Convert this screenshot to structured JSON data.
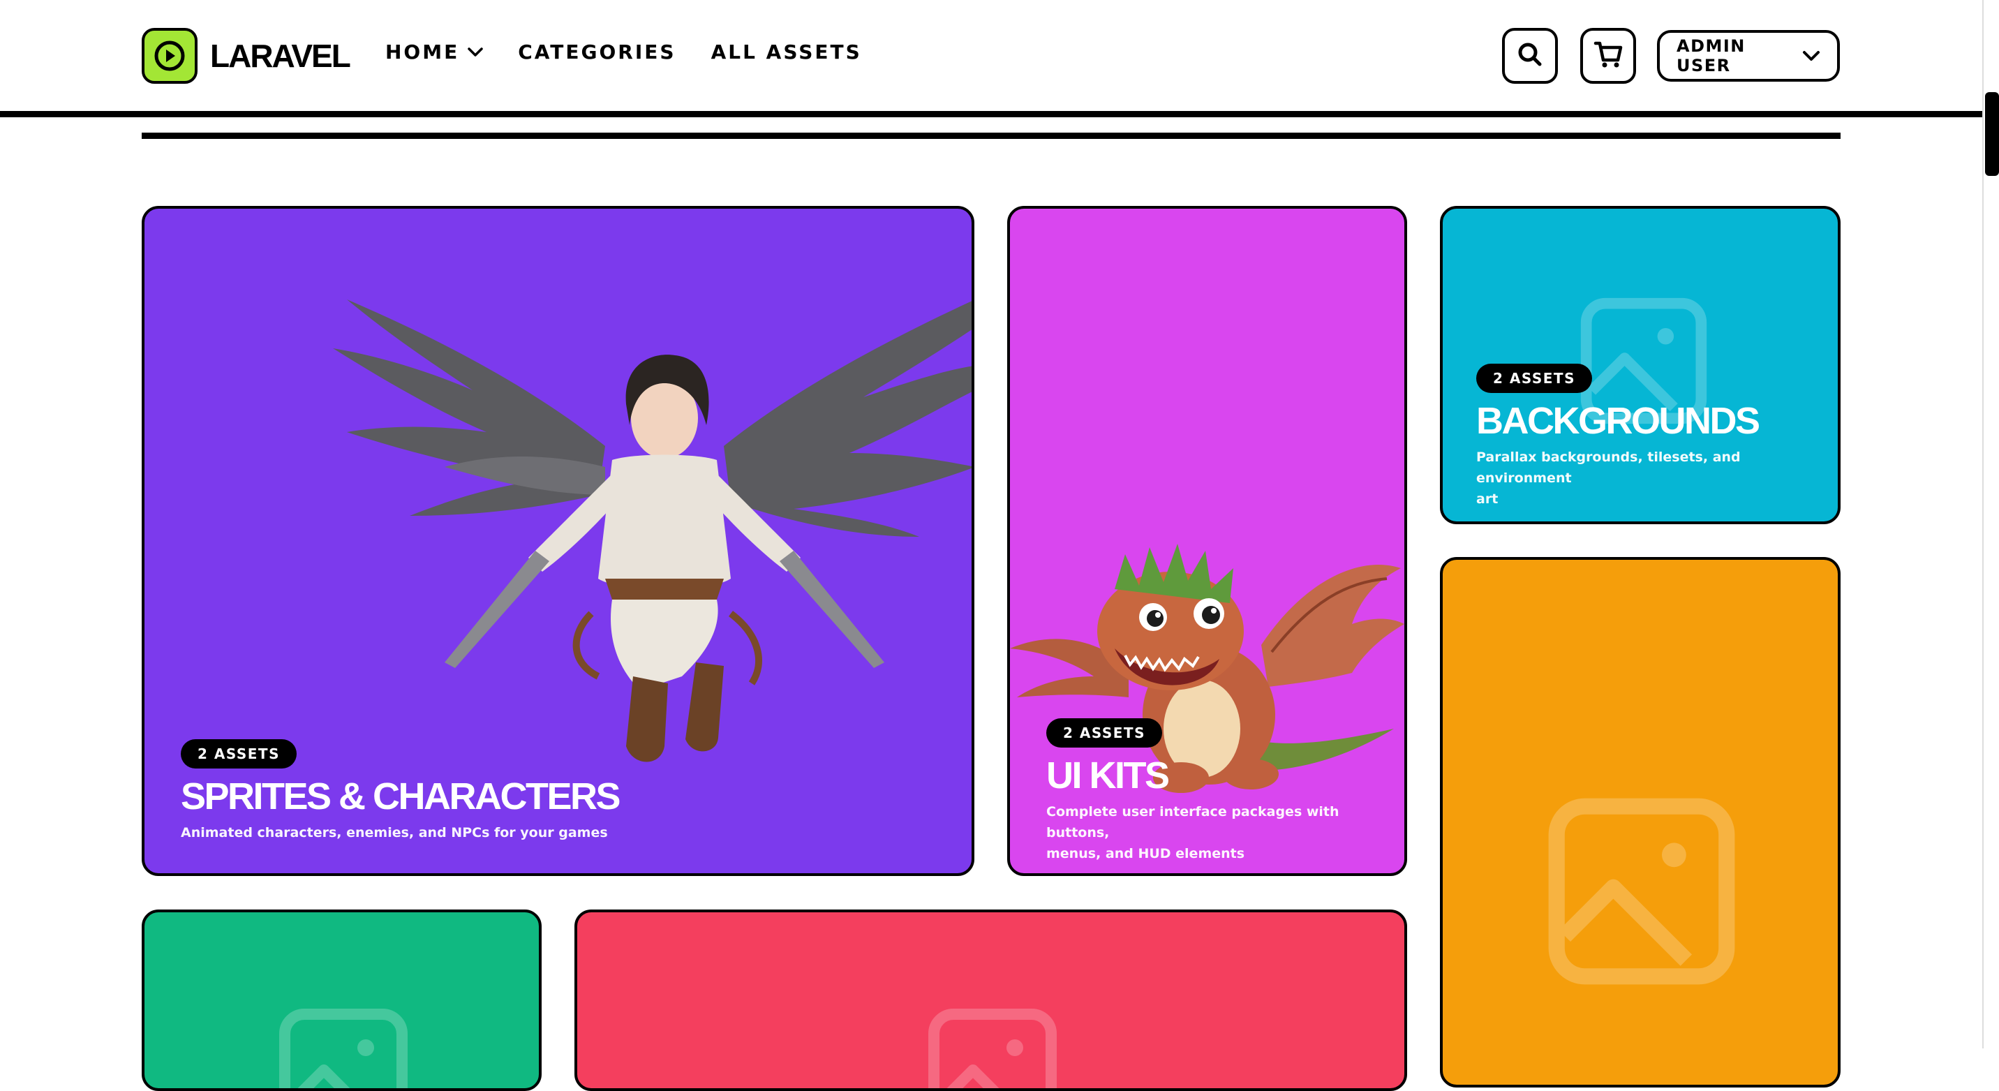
{
  "brand": {
    "name": "LARAVEL",
    "accent": "#a3e635"
  },
  "nav": {
    "home": "HOME",
    "categories": "CATEGORIES",
    "all_assets": "ALL ASSETS"
  },
  "actions": {
    "search_icon": "search-icon",
    "cart_icon": "cart-icon",
    "user_label": "ADMIN USER"
  },
  "cards": {
    "sprites": {
      "badge": "2 ASSETS",
      "title": "SPRITES & CHARACTERS",
      "description": "Animated characters, enemies, and NPCs for your games",
      "color": "#7c3aed"
    },
    "uikits": {
      "badge": "2 ASSETS",
      "title": "UI KITS",
      "description_line1": "Complete user interface packages with buttons,",
      "description_line2": "menus, and HUD elements",
      "color": "#d946ef"
    },
    "backgrounds": {
      "badge": "2 ASSETS",
      "title": "BACKGROUNDS",
      "description_line1": "Parallax backgrounds, tilesets, and environment",
      "description_line2": "art",
      "color": "#06b6d4"
    },
    "orange": {
      "color": "#f59e0b"
    },
    "green": {
      "color": "#10b981"
    },
    "red": {
      "color": "#f43f5e"
    }
  }
}
